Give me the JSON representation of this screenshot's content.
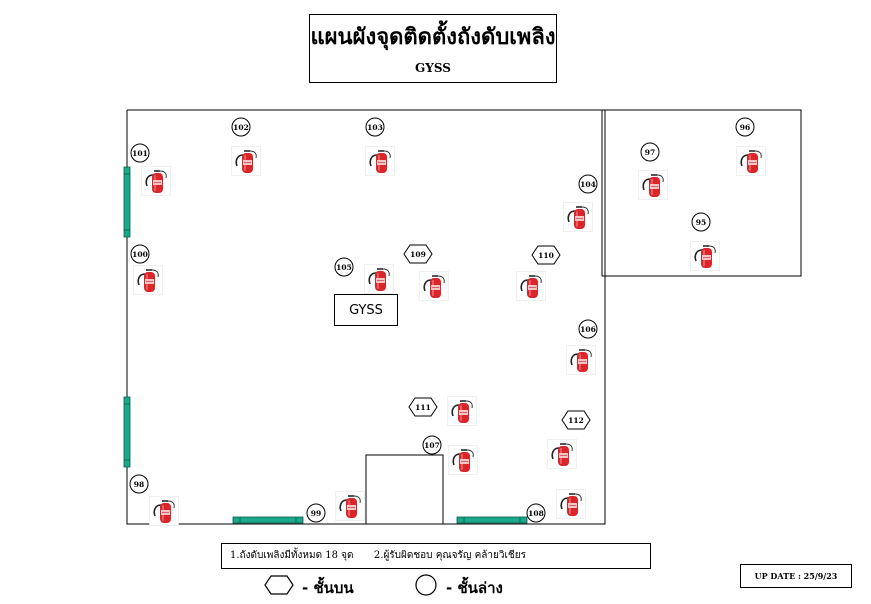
{
  "title": "แผนผังจุดติดตั้งถังดับเพลิง",
  "subtitle": "GYSS",
  "building_label": "GYSS",
  "icons": {
    "extinguisher": "fire-extinguisher-icon",
    "upper_floor": "hexagon-icon",
    "lower_floor": "circle-icon"
  },
  "colors": {
    "door": "#1aa88a",
    "extinguisher": "#d9262b"
  },
  "markers": [
    {
      "id": "101",
      "shape": "circle"
    },
    {
      "id": "102",
      "shape": "circle"
    },
    {
      "id": "103",
      "shape": "circle"
    },
    {
      "id": "104",
      "shape": "circle"
    },
    {
      "id": "100",
      "shape": "circle"
    },
    {
      "id": "105",
      "shape": "circle"
    },
    {
      "id": "109",
      "shape": "hexagon"
    },
    {
      "id": "110",
      "shape": "hexagon"
    },
    {
      "id": "106",
      "shape": "circle"
    },
    {
      "id": "111",
      "shape": "hexagon"
    },
    {
      "id": "112",
      "shape": "hexagon"
    },
    {
      "id": "107",
      "shape": "circle"
    },
    {
      "id": "98",
      "shape": "circle"
    },
    {
      "id": "99",
      "shape": "circle"
    },
    {
      "id": "108",
      "shape": "circle"
    },
    {
      "id": "97",
      "shape": "circle"
    },
    {
      "id": "96",
      "shape": "circle"
    },
    {
      "id": "95",
      "shape": "circle"
    }
  ],
  "notes": {
    "note1": "1.ถังดับเพลิงมีทั้งหมด 18 จุด",
    "note2": "2.ผู้รับผิดชอบ คุณจรัญ คล้ายวิเชียร"
  },
  "legend": {
    "upper": "-  ชั้นบน",
    "lower": "-  ชั้นล่าง"
  },
  "update": "UP DATE :  25/9/23"
}
